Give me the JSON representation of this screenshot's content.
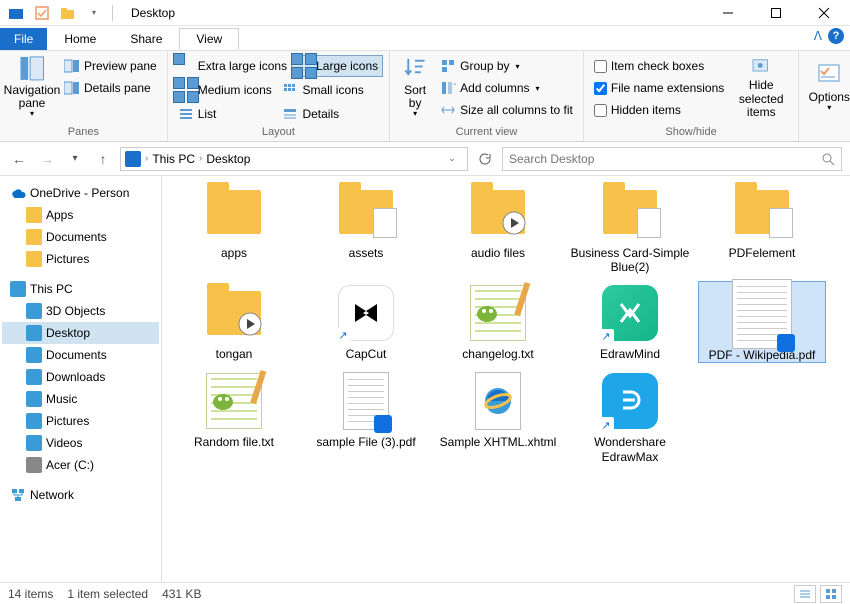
{
  "title": "Desktop",
  "tabs": {
    "file": "File",
    "home": "Home",
    "share": "Share",
    "view": "View"
  },
  "ribbon": {
    "panes": {
      "nav_pane": "Navigation\npane",
      "preview_pane": "Preview pane",
      "details_pane": "Details pane",
      "label": "Panes"
    },
    "layout": {
      "extra_large": "Extra large icons",
      "large": "Large icons",
      "medium": "Medium icons",
      "small": "Small icons",
      "list": "List",
      "details": "Details",
      "label": "Layout"
    },
    "currentview": {
      "sort_by": "Sort\nby",
      "group_by": "Group by",
      "add_columns": "Add columns",
      "size_cols": "Size all columns to fit",
      "label": "Current view"
    },
    "showhide": {
      "item_check": "Item check boxes",
      "file_ext": "File name extensions",
      "hidden": "Hidden items",
      "hide_selected": "Hide selected\nitems",
      "label": "Show/hide"
    },
    "options": "Options"
  },
  "breadcrumbs": [
    "This PC",
    "Desktop"
  ],
  "search_placeholder": "Search Desktop",
  "tree": [
    {
      "key": "onedrive",
      "label": "OneDrive - Person",
      "icon": "onedrive"
    },
    {
      "key": "apps",
      "label": "Apps",
      "icon": "folder",
      "child": true
    },
    {
      "key": "documents1",
      "label": "Documents",
      "icon": "folder",
      "child": true
    },
    {
      "key": "pictures1",
      "label": "Pictures",
      "icon": "folder",
      "child": true
    },
    {
      "key": "thispc",
      "label": "This PC",
      "icon": "pc"
    },
    {
      "key": "3dobjects",
      "label": "3D Objects",
      "icon": "pc",
      "child": true
    },
    {
      "key": "desktop",
      "label": "Desktop",
      "icon": "pc",
      "child": true,
      "selected": true
    },
    {
      "key": "documents2",
      "label": "Documents",
      "icon": "pc",
      "child": true
    },
    {
      "key": "downloads",
      "label": "Downloads",
      "icon": "pc",
      "child": true
    },
    {
      "key": "music",
      "label": "Music",
      "icon": "pc",
      "child": true
    },
    {
      "key": "pictures2",
      "label": "Pictures",
      "icon": "pc",
      "child": true
    },
    {
      "key": "videos",
      "label": "Videos",
      "icon": "pc",
      "child": true
    },
    {
      "key": "acer",
      "label": "Acer (C:)",
      "icon": "drive",
      "child": true
    },
    {
      "key": "network",
      "label": "Network",
      "icon": "network"
    }
  ],
  "files": [
    {
      "name": "apps",
      "type": "folder"
    },
    {
      "name": "assets",
      "type": "folder-doc"
    },
    {
      "name": "audio files",
      "type": "folder-media"
    },
    {
      "name": "Business Card-Simple Blue(2)",
      "type": "folder-doc"
    },
    {
      "name": "PDFelement",
      "type": "folder-doc"
    },
    {
      "name": "tongan",
      "type": "folder-media"
    },
    {
      "name": "CapCut",
      "type": "app-capcut"
    },
    {
      "name": "changelog.txt",
      "type": "notepadpp"
    },
    {
      "name": "EdrawMind",
      "type": "app-edrawmind"
    },
    {
      "name": "PDF - Wikipedia.pdf",
      "type": "pdf-doc",
      "selected": true
    },
    {
      "name": "Random file.txt",
      "type": "notepadpp"
    },
    {
      "name": "sample File (3).pdf",
      "type": "pdf-plain"
    },
    {
      "name": "Sample XHTML.xhtml",
      "type": "ie"
    },
    {
      "name": "Wondershare EdrawMax",
      "type": "app-edrawmax"
    }
  ],
  "status": {
    "count": "14 items",
    "selected": "1 item selected",
    "size": "431 KB"
  }
}
